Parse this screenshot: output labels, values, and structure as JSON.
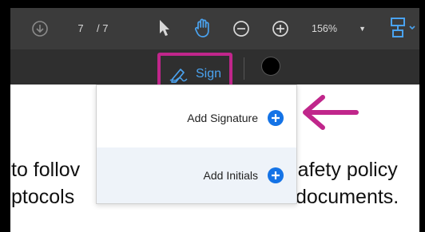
{
  "toolbar": {
    "current_page": "7",
    "page_separator": "/ 7",
    "zoom_value": "156%"
  },
  "sign_tool": {
    "label": "Sign"
  },
  "dropdown": {
    "items": [
      {
        "label": "Add Signature"
      },
      {
        "label": "Add Initials"
      }
    ]
  },
  "document": {
    "line1_left": "to follov",
    "line1_right": "Safety policy",
    "line2_left": "ptocols",
    "line2_right": "documents."
  },
  "colors": {
    "highlight": "#c0268b",
    "accent": "#1473e6",
    "sign_text": "#4aa3f0"
  }
}
